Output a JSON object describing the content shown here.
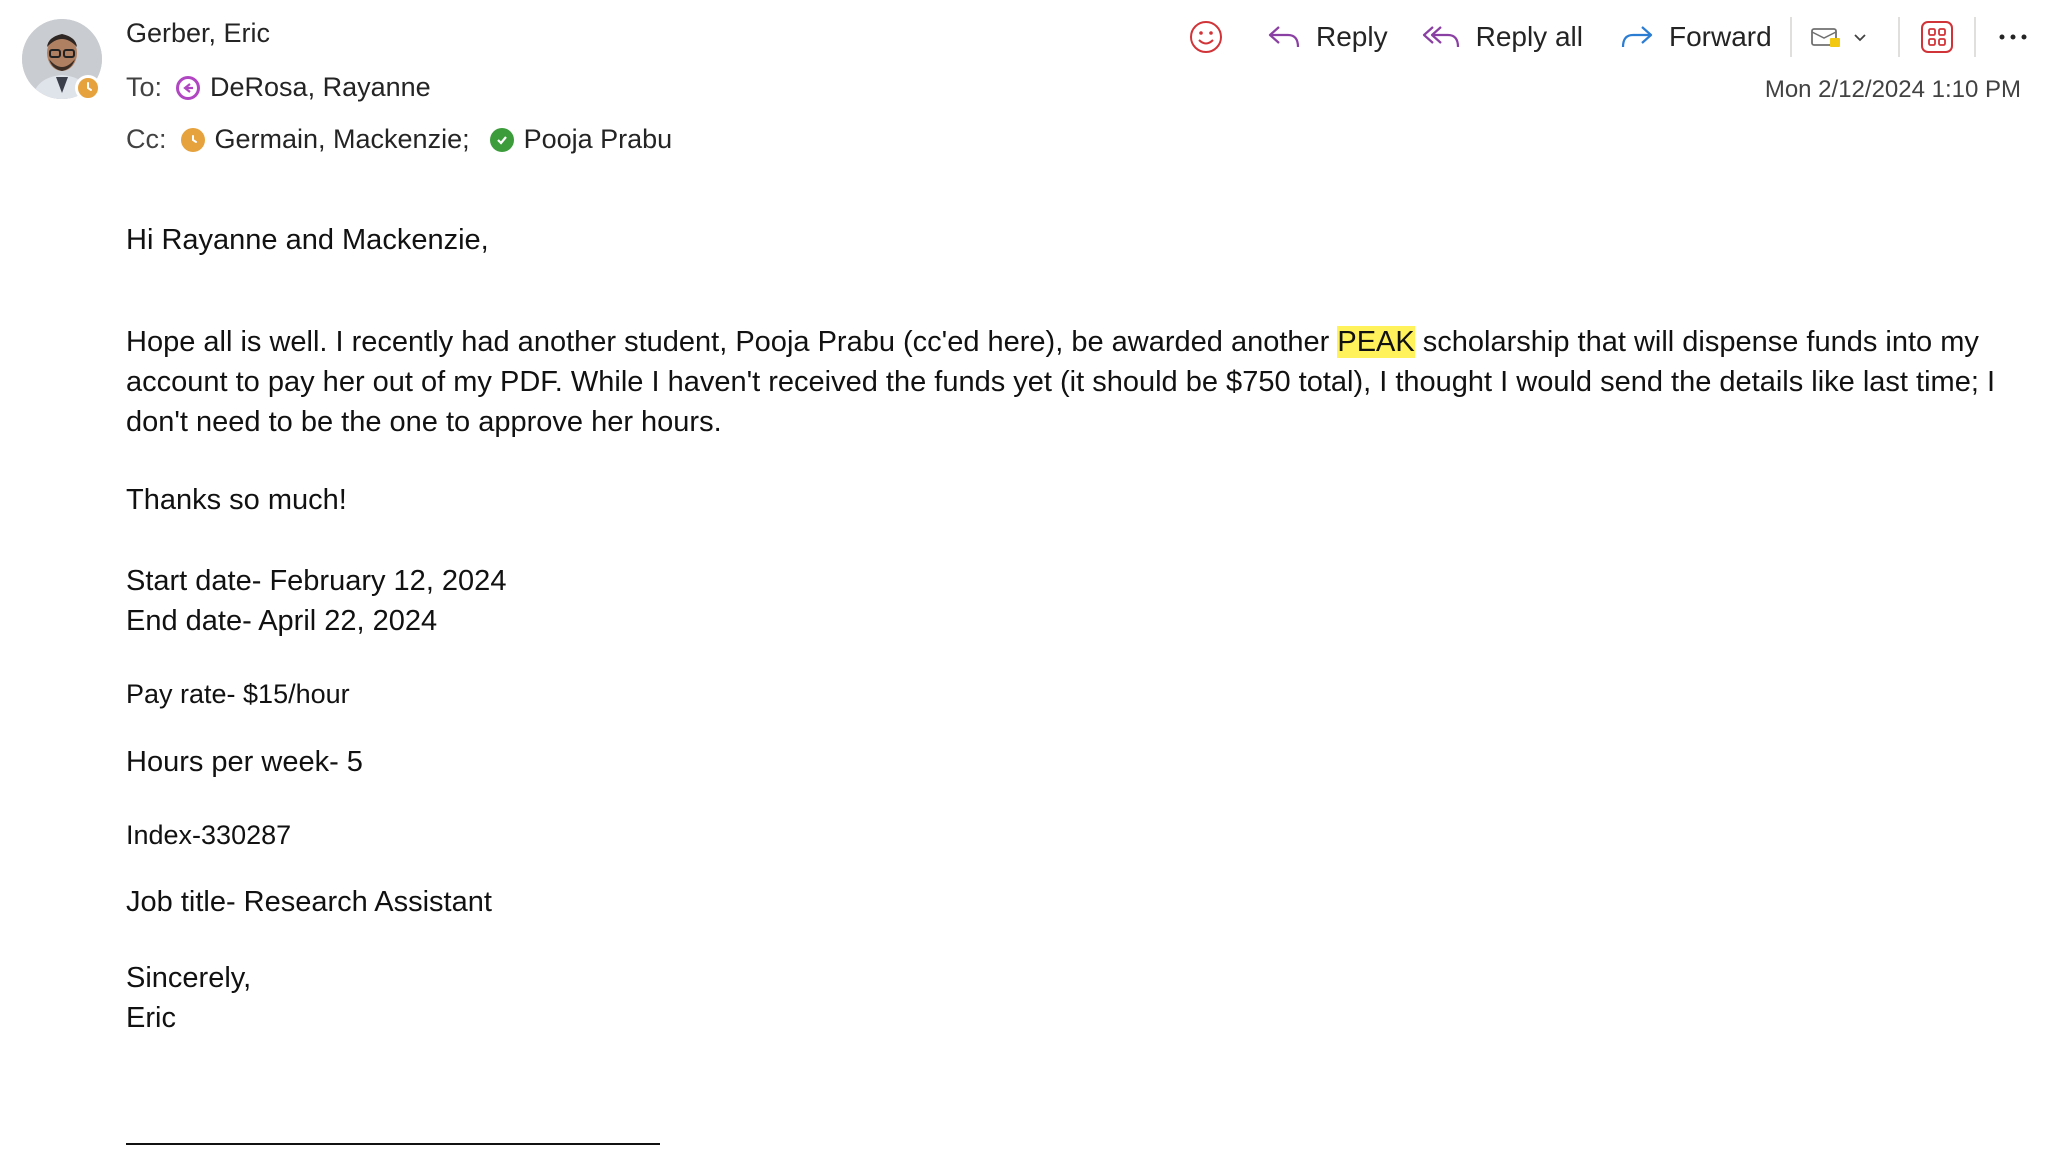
{
  "sender": {
    "name": "Gerber, Eric"
  },
  "recipients": {
    "to_label": "To:",
    "to": "DeRosa, Rayanne",
    "cc_label": "Cc:",
    "cc": [
      "Germain, Mackenzie;",
      "Pooja Prabu"
    ]
  },
  "date": "Mon 2/12/2024 1:10 PM",
  "toolbar": {
    "reply": "Reply",
    "reply_all": "Reply all",
    "forward": "Forward"
  },
  "body": {
    "greeting": "Hi Rayanne and Mackenzie,",
    "para_before": "Hope all is well. I recently had another student, Pooja Prabu (cc'ed here), be awarded another ",
    "highlight": "PEAK",
    "para_after": " scholarship that will dispense funds into my account to pay her out of my PDF. While I haven't received the funds yet (it should be $750 total), I thought I would send the details like last time; I don't need to be the one to approve her hours.",
    "thanks": "Thanks so much!",
    "start_date": "Start date- February 12, 2024",
    "end_date": "End date- April 22, 2024",
    "pay_rate": "Pay rate- $15/hour",
    "hours": "Hours per week- 5",
    "index": "Index-330287",
    "job_title": "Job title- Research Assistant",
    "closing": "Sincerely,",
    "signature": "Eric"
  },
  "colors": {
    "reply_icon": "#8a3fa3",
    "forward_icon": "#2b7cd3",
    "emoji_icon": "#d13438",
    "apps_icon": "#d13438",
    "highlight": "#fff25a"
  }
}
